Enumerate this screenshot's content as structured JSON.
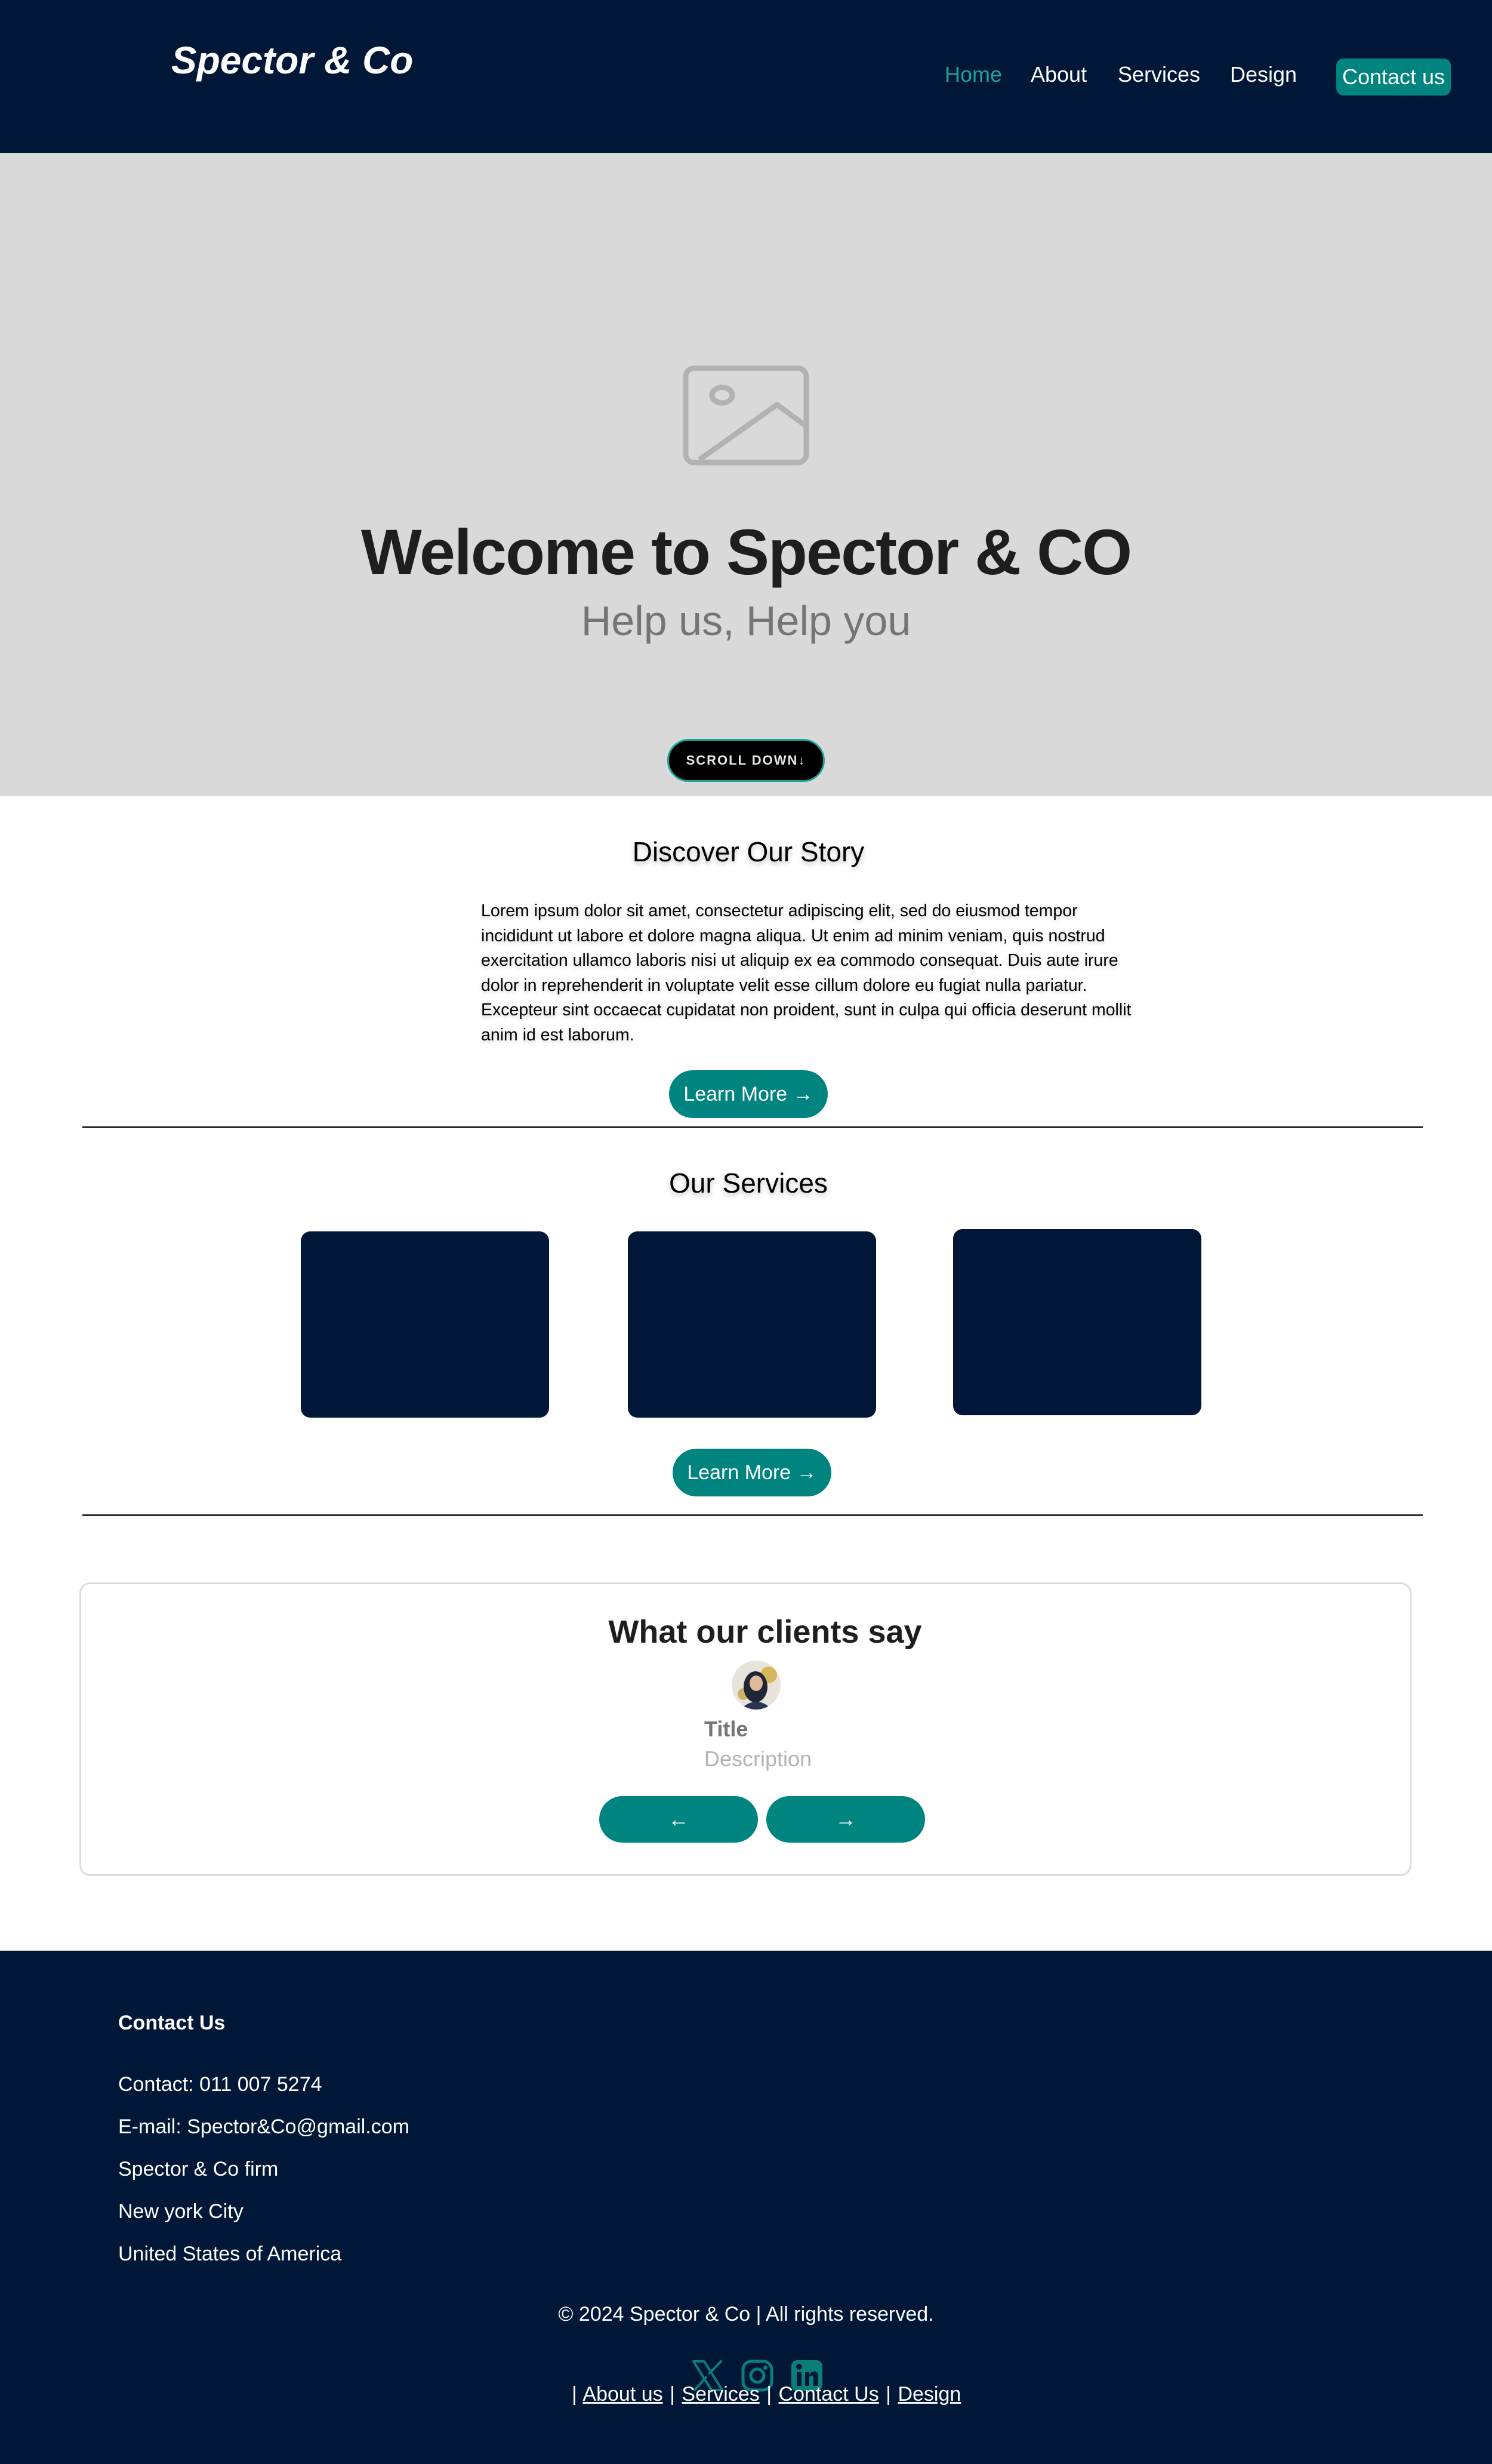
{
  "header": {
    "logo": "Spector & Co",
    "nav": [
      "Home",
      "About",
      "Services",
      "Design"
    ],
    "cta": "Contact us"
  },
  "hero": {
    "title": "Welcome to Spector & CO",
    "subtitle": "Help us, Help you",
    "scroll_button": "SCROLL DOWN↓"
  },
  "story": {
    "title": "Discover Our Story",
    "text": "Lorem ipsum dolor sit amet, consectetur adipiscing elit, sed do eiusmod tempor incididunt ut labore et dolore magna aliqua. Ut enim ad minim veniam, quis nostrud exercitation ullamco laboris nisi ut aliquip ex ea commodo consequat. Duis aute irure dolor in reprehenderit in voluptate velit esse cillum dolore eu fugiat nulla pariatur. Excepteur sint occaecat cupidatat non proident, sunt in culpa qui officia deserunt mollit anim id est laborum.",
    "button": "Learn More →"
  },
  "services": {
    "title": "Our Services",
    "button": "Learn More →"
  },
  "testimonials": {
    "title": "What our clients say",
    "item_title": "Title",
    "item_description": "Description",
    "prev": "←",
    "next": "→"
  },
  "footer": {
    "heading": "Contact Us",
    "lines": [
      "Contact: 011 007 5274",
      "E-mail: Spector&Co@gmail.com",
      "Spector & Co firm",
      "New york City",
      "United States of America"
    ],
    "copyright": "© 2024 Spector & Co | All rights reserved.",
    "links": [
      "About us",
      "Services",
      "Contact Us",
      "Design"
    ],
    "link_separator": "|"
  },
  "colors": {
    "navy": "#001737",
    "teal": "#00847f",
    "hero_gray": "#d9d9d9"
  },
  "icons": [
    "image-placeholder-icon",
    "x-icon",
    "instagram-icon",
    "linkedin-icon"
  ]
}
